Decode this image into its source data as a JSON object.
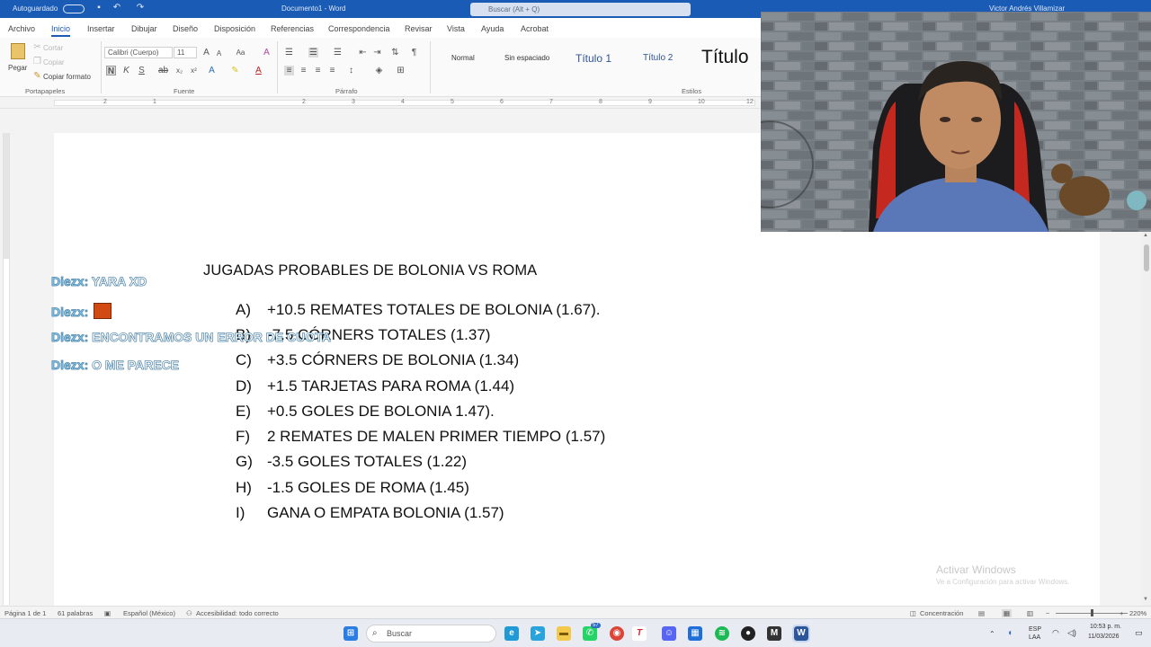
{
  "titlebar": {
    "autosave_label": "Autoguardado",
    "doc_name": "Documento1 - Word",
    "search_placeholder": "Buscar (Alt + Q)",
    "user_name": "Victor Andrés Villamizar"
  },
  "tabs": [
    "Archivo",
    "Inicio",
    "Insertar",
    "Dibujar",
    "Diseño",
    "Disposición",
    "Referencias",
    "Correspondencia",
    "Revisar",
    "Vista",
    "Ayuda",
    "Acrobat"
  ],
  "ribbon": {
    "paste_label": "Pegar",
    "cut_label": "Cortar",
    "copy_label": "Copiar",
    "format_painter_label": "Copiar formato",
    "clipboard_group": "Portapapeles",
    "font_name": "Calibri (Cuerpo)",
    "font_size": "11",
    "font_group": "Fuente",
    "paragraph_group": "Párrafo",
    "styles_group": "Estilos",
    "styles": [
      "Normal",
      "Sin espaciado",
      "Título 1",
      "Título 2",
      "Título"
    ]
  },
  "document": {
    "title": "JUGADAS PROBABLES DE BOLONIA VS ROMA",
    "items": [
      {
        "letter": "A)",
        "text": "+10.5 REMATES TOTALES DE BOLONIA (1.67)."
      },
      {
        "letter": "B)",
        "text": "-7.5 CÓRNERS TOTALES (1.37)"
      },
      {
        "letter": "C)",
        "text": "+3.5 CÓRNERS DE BOLONIA (1.34)"
      },
      {
        "letter": "D)",
        "text": "+1.5 TARJETAS PARA ROMA (1.44)"
      },
      {
        "letter": "E)",
        "text": "+0.5 GOLES DE BOLONIA 1.47)."
      },
      {
        "letter": "F)",
        "text": "2 REMATES DE MALEN PRIMER TIEMPO (1.57)"
      },
      {
        "letter": "G)",
        "text": "-3.5 GOLES TOTALES (1.22)"
      },
      {
        "letter": "H)",
        "text": "-1.5 GOLES DE ROMA (1.45)"
      },
      {
        "letter": "I)",
        "text": "GANA O EMPATA BOLONIA (1.57)"
      }
    ]
  },
  "chat": [
    {
      "user": "Diezx:",
      "message": "YARA XD"
    },
    {
      "user": "Diezx:",
      "message": ""
    },
    {
      "user": "Diezx:",
      "message": "ENCONTRAMOS UN ERROR DE CUOTA"
    },
    {
      "user": "Diezx:",
      "message": "O ME PARECE"
    }
  ],
  "watermark": {
    "title": "Activar Windows",
    "subtitle": "Ve a Configuración para activar Windows."
  },
  "statusbar": {
    "page": "Página 1 de 1",
    "words": "61 palabras",
    "language": "Español (México)",
    "accessibility": "Accesibilidad: todo correcto",
    "focus": "Concentración",
    "zoom": "220%"
  },
  "taskbar": {
    "search_placeholder": "Buscar",
    "badge_count": "57",
    "lang_top": "ESP",
    "lang_bottom": "LAA",
    "time": "10:53 p. m.",
    "date": "11/03/2026"
  }
}
